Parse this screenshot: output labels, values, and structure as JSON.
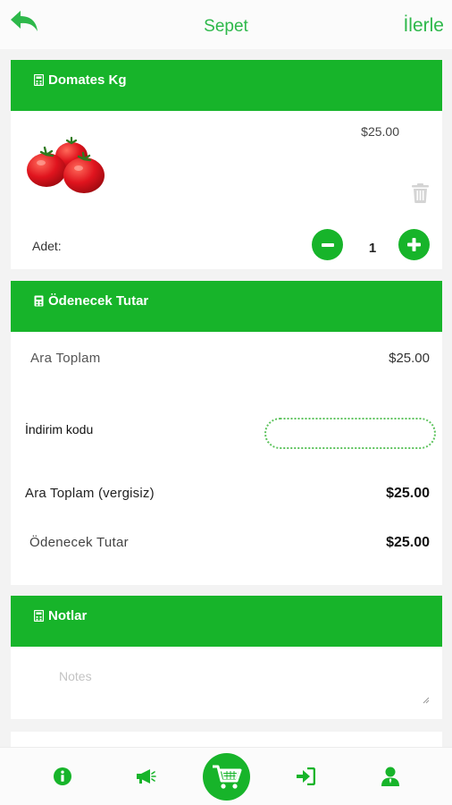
{
  "header": {
    "title": "Sepet",
    "next_label": "İlerle"
  },
  "product": {
    "name": "Domates Kg",
    "price": "$25.00",
    "quantity_label": "Adet:",
    "quantity": "1"
  },
  "totals": {
    "title": "Ödenecek Tutar",
    "subtotal_label": "Ara Toplam",
    "subtotal_value": "$25.00",
    "discount_label": "İndirim kodu",
    "discount_value": "",
    "net_label": "Ara Toplam (vergisiz)",
    "net_value": "$25.00",
    "payable_label": "Ödenecek Tutar",
    "payable_value": "$25.00"
  },
  "notes": {
    "title": "Notlar",
    "placeholder": "Notes"
  },
  "bottom_nav": [
    "info-icon",
    "megaphone-icon",
    "cart-icon",
    "sign-in-icon",
    "user-icon"
  ],
  "colors": {
    "accent": "#17b42a",
    "header_text": "#2db84a"
  }
}
